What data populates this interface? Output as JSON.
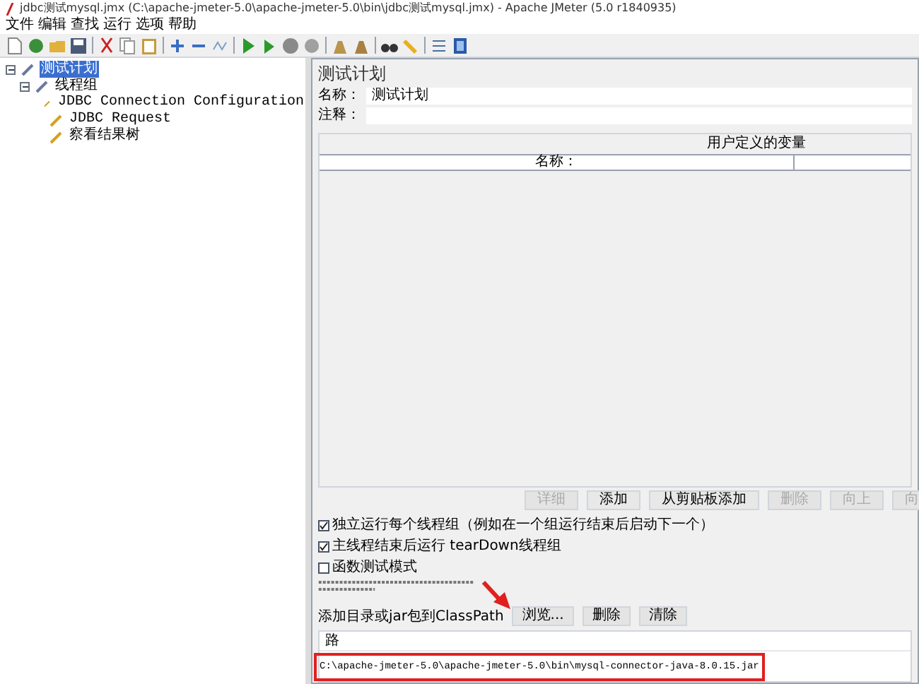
{
  "window": {
    "title": "jdbc测试mysql.jmx (C:\\apache-jmeter-5.0\\apache-jmeter-5.0\\bin\\jdbc测试mysql.jmx) - Apache JMeter (5.0 r1840935)"
  },
  "menu": [
    "文件",
    "编辑",
    "查找",
    "运行",
    "选项",
    "帮助"
  ],
  "tree": [
    {
      "label": "测试计划",
      "selected": true,
      "expanded": true,
      "children": [
        {
          "label": "线程组",
          "selected": false,
          "expanded": true,
          "children": [
            {
              "label": "JDBC Connection Configuration",
              "selected": false
            },
            {
              "label": "JDBC Request",
              "selected": false
            },
            {
              "label": "察看结果树",
              "selected": false
            }
          ]
        }
      ]
    }
  ],
  "panel": {
    "title": "测试计划",
    "name_label": "名称：",
    "name_value": "测试计划",
    "comment_label": "注释：",
    "variables": {
      "title": "用户定义的变量",
      "columns": [
        "名称："
      ]
    },
    "buttons": [
      {
        "label": "详细",
        "disabled": true
      },
      {
        "label": "添加",
        "disabled": false
      },
      {
        "label": "从剪贴板添加",
        "disabled": false
      },
      {
        "label": "删除",
        "disabled": true
      },
      {
        "label": "向上",
        "disabled": true
      },
      {
        "label": "向",
        "disabled": true
      }
    ],
    "options": [
      {
        "label": "独立运行每个线程组（例如在一个组运行结束后启动下一个）",
        "checked": true
      },
      {
        "label": "主线程结束后运行 tearDown线程组",
        "checked": true
      },
      {
        "label": "函数测试模式",
        "checked": false
      }
    ],
    "classpath": {
      "label": "添加目录或jar包到ClassPath",
      "buttons": [
        "浏览...",
        "删除",
        "清除"
      ],
      "column": "路",
      "rows": [
        "C:\\apache-jmeter-5.0\\apache-jmeter-5.0\\bin\\mysql-connector-java-8.0.15.jar"
      ]
    }
  }
}
